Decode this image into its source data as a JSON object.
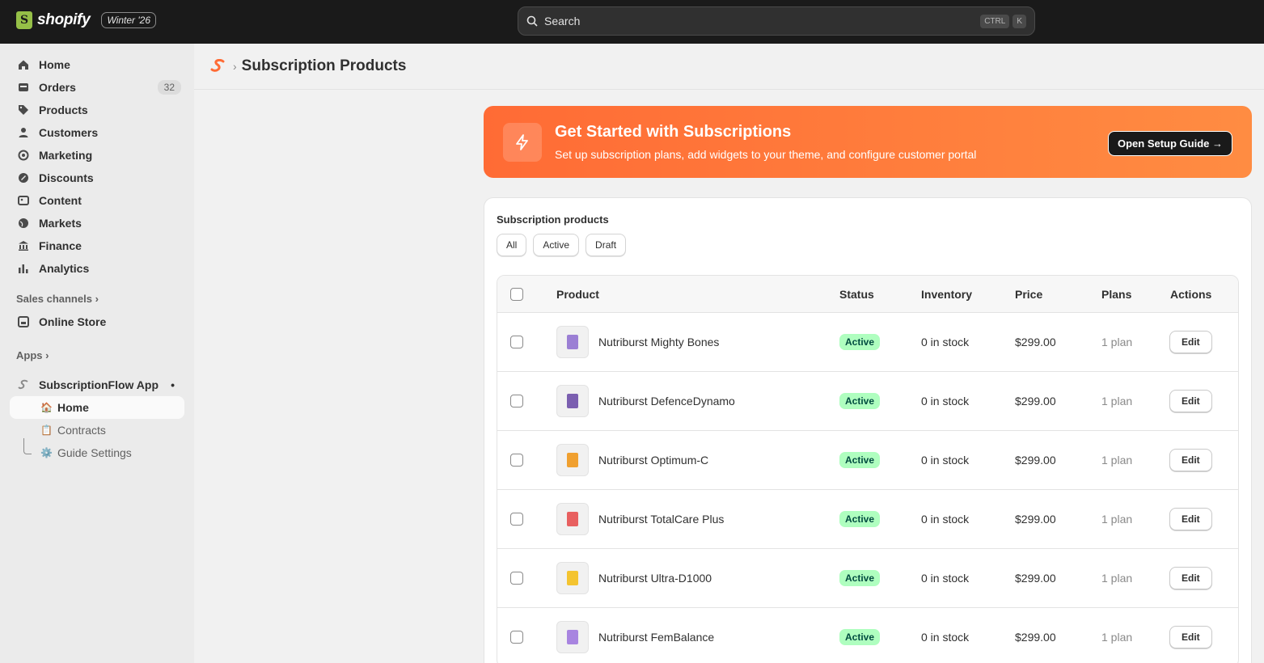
{
  "topbar": {
    "brand": "shopify",
    "edition": "Winter '26",
    "search_placeholder": "Search",
    "shortcut": [
      "CTRL",
      "K"
    ]
  },
  "sidebar": {
    "items": [
      {
        "label": "Home",
        "icon": "home-icon"
      },
      {
        "label": "Orders",
        "icon": "orders-icon",
        "badge": "32"
      },
      {
        "label": "Products",
        "icon": "tag-icon"
      },
      {
        "label": "Customers",
        "icon": "person-icon"
      },
      {
        "label": "Marketing",
        "icon": "target-icon"
      },
      {
        "label": "Discounts",
        "icon": "discount-icon"
      },
      {
        "label": "Content",
        "icon": "content-icon"
      },
      {
        "label": "Markets",
        "icon": "globe-icon"
      },
      {
        "label": "Finance",
        "icon": "bank-icon"
      },
      {
        "label": "Analytics",
        "icon": "bar-chart-icon"
      }
    ],
    "sales_channels_label": "Sales channels",
    "online_store": "Online Store",
    "apps_label": "Apps",
    "app_name": "SubscriptionFlow App",
    "app_subitems": [
      {
        "label": "Home",
        "icon": "house-emoji-icon"
      },
      {
        "label": "Contracts",
        "icon": "clipboard-emoji-icon"
      },
      {
        "label": "Guide Settings",
        "icon": "gear-emoji-icon"
      }
    ]
  },
  "header": {
    "title": "Subscription Products",
    "separator": "›"
  },
  "banner": {
    "title": "Get Started with Subscriptions",
    "subtitle": "Set up subscription plans, add widgets to your theme, and configure customer portal",
    "button": "Open Setup Guide →",
    "colors": {
      "start": "#ff6b35",
      "end": "#ff8c42"
    }
  },
  "products_card": {
    "title": "Subscription products",
    "filters": [
      "All",
      "Active",
      "Draft"
    ],
    "columns": [
      "Product",
      "Status",
      "Inventory",
      "Price",
      "Plans",
      "Actions"
    ],
    "rows": [
      {
        "name": "Nutriburst Mighty Bones",
        "status": "Active",
        "inventory": "0 in stock",
        "price": "$299.00",
        "plans": "1 plan",
        "action": "Edit",
        "thumb_color": "#9b7fd4"
      },
      {
        "name": "Nutriburst DefenceDynamo",
        "status": "Active",
        "inventory": "0 in stock",
        "price": "$299.00",
        "plans": "1 plan",
        "action": "Edit",
        "thumb_color": "#7b5fb0"
      },
      {
        "name": "Nutriburst Optimum-C",
        "status": "Active",
        "inventory": "0 in stock",
        "price": "$299.00",
        "plans": "1 plan",
        "action": "Edit",
        "thumb_color": "#f0a030"
      },
      {
        "name": "Nutriburst TotalCare Plus",
        "status": "Active",
        "inventory": "0 in stock",
        "price": "$299.00",
        "plans": "1 plan",
        "action": "Edit",
        "thumb_color": "#e86060"
      },
      {
        "name": "Nutriburst Ultra-D1000",
        "status": "Active",
        "inventory": "0 in stock",
        "price": "$299.00",
        "plans": "1 plan",
        "action": "Edit",
        "thumb_color": "#f4c430"
      },
      {
        "name": "Nutriburst FemBalance",
        "status": "Active",
        "inventory": "0 in stock",
        "price": "$299.00",
        "plans": "1 plan",
        "action": "Edit",
        "thumb_color": "#a884e0"
      }
    ]
  }
}
